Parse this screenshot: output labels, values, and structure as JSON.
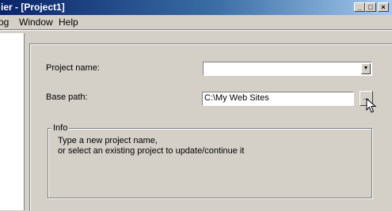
{
  "window": {
    "title": "ier - [Project1]",
    "minimize_glyph": "_",
    "maximize_glyph": "□",
    "close_glyph": "×"
  },
  "menu": {
    "items": [
      "og",
      "Window",
      "Help"
    ]
  },
  "form": {
    "project_name_label": "Project name:",
    "project_name_value": "",
    "base_path_label": "Base path:",
    "base_path_value": "C:\\My Web Sites",
    "browse_button_label": "...",
    "combo_arrow_glyph": "▼"
  },
  "info": {
    "group_label": "Info",
    "line1": "Type a new project name,",
    "line2": "or select an existing project to update/continue it"
  },
  "colors": {
    "titlebar_start": "#0a246a",
    "titlebar_end": "#a6caf0",
    "face": "#d4d0c8"
  }
}
